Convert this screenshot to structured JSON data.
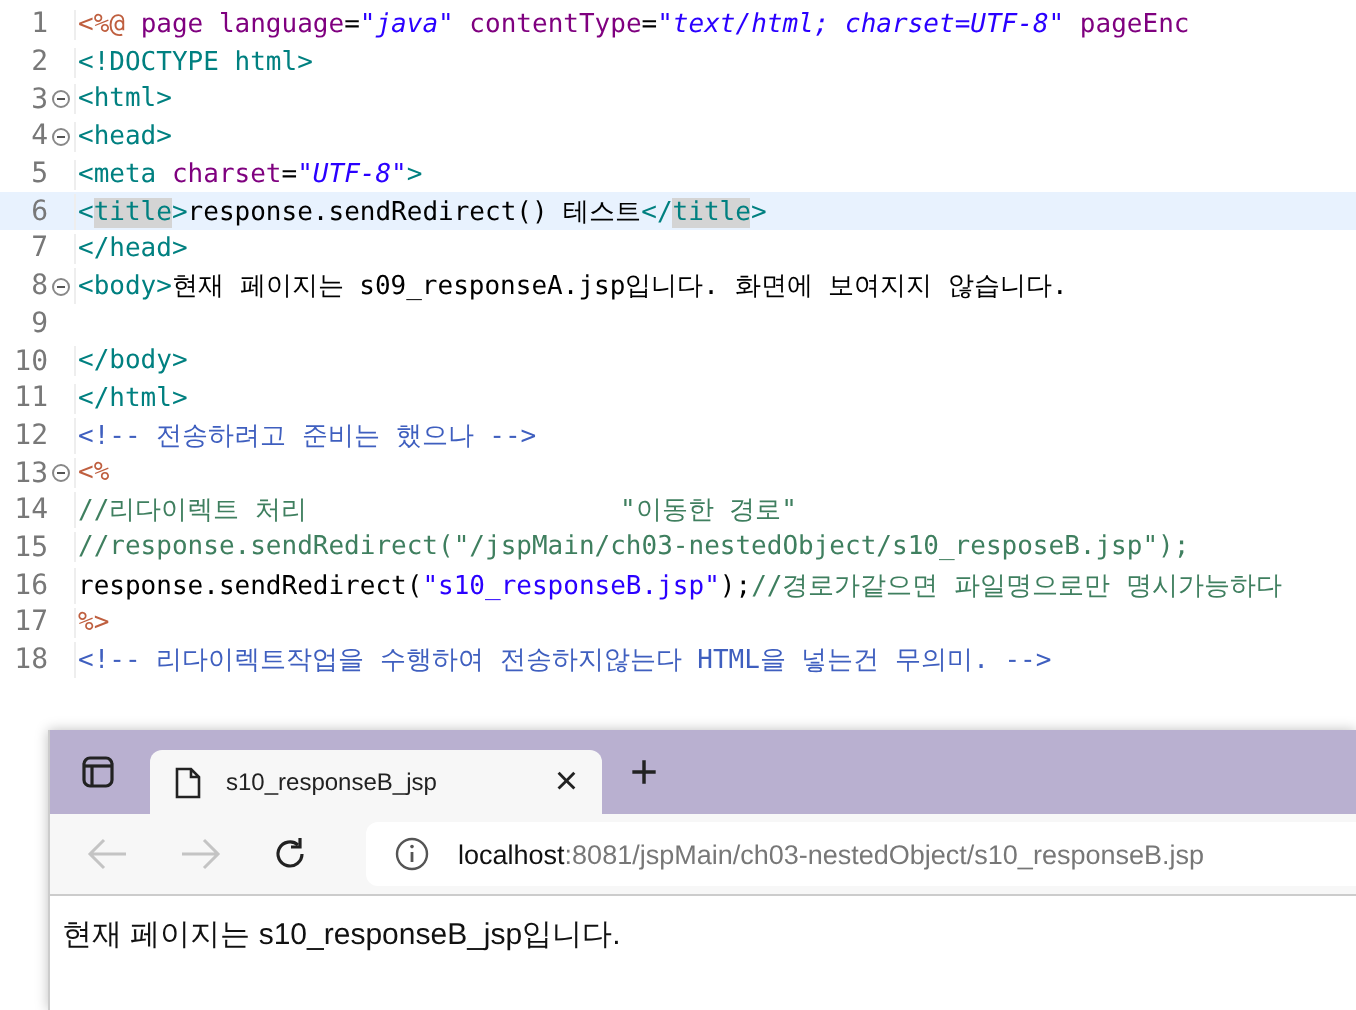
{
  "editor": {
    "lines": [
      {
        "number": "1",
        "foldable": false,
        "current": false,
        "tokens": [
          {
            "kind": "directive",
            "text": "<%@ "
          },
          {
            "kind": "attr",
            "text": "page language"
          },
          {
            "kind": "text",
            "text": "="
          },
          {
            "kind": "string",
            "text": "\"java\""
          },
          {
            "kind": "attr",
            "text": " contentType"
          },
          {
            "kind": "text",
            "text": "="
          },
          {
            "kind": "string",
            "text": "\"text/html; charset=UTF-8\""
          },
          {
            "kind": "attr",
            "text": " pageEnc"
          }
        ]
      },
      {
        "number": "2",
        "foldable": false,
        "current": false,
        "tokens": [
          {
            "kind": "tag",
            "text": "<!DOCTYPE html>"
          }
        ]
      },
      {
        "number": "3",
        "foldable": true,
        "current": false,
        "tokens": [
          {
            "kind": "tag",
            "text": "<html>"
          }
        ]
      },
      {
        "number": "4",
        "foldable": true,
        "current": false,
        "tokens": [
          {
            "kind": "tag",
            "text": "<head>"
          }
        ]
      },
      {
        "number": "5",
        "foldable": false,
        "current": false,
        "tokens": [
          {
            "kind": "tag",
            "text": "<meta "
          },
          {
            "kind": "attr",
            "text": "charset"
          },
          {
            "kind": "text",
            "text": "="
          },
          {
            "kind": "string",
            "text": "\"UTF-8\""
          },
          {
            "kind": "tag",
            "text": ">"
          }
        ]
      },
      {
        "number": "6",
        "foldable": false,
        "current": true,
        "tokens": [
          {
            "kind": "tag",
            "text": "<"
          },
          {
            "kind": "tag-match",
            "text": "title"
          },
          {
            "kind": "tag",
            "text": ">"
          },
          {
            "kind": "text",
            "text": "response.sendRedirect() 테스트"
          },
          {
            "kind": "tag",
            "text": "</"
          },
          {
            "kind": "tag-match",
            "text": "title"
          },
          {
            "kind": "tag",
            "text": ">"
          }
        ]
      },
      {
        "number": "7",
        "foldable": false,
        "current": false,
        "tokens": [
          {
            "kind": "tag",
            "text": "</head>"
          }
        ]
      },
      {
        "number": "8",
        "foldable": true,
        "current": false,
        "tokens": [
          {
            "kind": "tag",
            "text": "<body>"
          },
          {
            "kind": "text",
            "text": "현재 페이지는 s09_responseA.jsp입니다. 화면에 보여지지 않습니다."
          }
        ]
      },
      {
        "number": "9",
        "foldable": false,
        "current": false
      },
      {
        "number": "10",
        "foldable": false,
        "current": false,
        "tokens": [
          {
            "kind": "tag",
            "text": "</body>"
          }
        ]
      },
      {
        "number": "11",
        "foldable": false,
        "current": false,
        "tokens": [
          {
            "kind": "tag",
            "text": "</html>"
          }
        ]
      },
      {
        "number": "12",
        "foldable": false,
        "current": false,
        "tokens": [
          {
            "kind": "comment",
            "text": "<!-- 전송하려고 준비는 했으나 -->"
          }
        ]
      },
      {
        "number": "13",
        "foldable": true,
        "current": false,
        "tokens": [
          {
            "kind": "directive",
            "text": "<%"
          }
        ]
      },
      {
        "number": "14",
        "foldable": false,
        "current": false,
        "tokens": [
          {
            "kind": "jcomment",
            "text": "//리다이렉트 처리                    \"이동한 경로\""
          }
        ]
      },
      {
        "number": "15",
        "foldable": false,
        "current": false,
        "tokens": [
          {
            "kind": "jcomment",
            "text": "//response.sendRedirect(\"/jspMain/ch03-nestedObject/s10_resposeB.jsp\");"
          }
        ]
      },
      {
        "number": "16",
        "foldable": false,
        "current": false,
        "tokens": [
          {
            "kind": "text",
            "text": "response.sendRedirect("
          },
          {
            "kind": "jstring",
            "text": "\"s10_responseB.jsp\""
          },
          {
            "kind": "text",
            "text": ");"
          },
          {
            "kind": "jcomment",
            "text": "//경로가같으면 파일명으로만 명시가능하다"
          }
        ]
      },
      {
        "number": "17",
        "foldable": false,
        "current": false,
        "tokens": [
          {
            "kind": "directive",
            "text": "%>"
          }
        ]
      },
      {
        "number": "18",
        "foldable": false,
        "current": false,
        "tokens": [
          {
            "kind": "comment",
            "text": "<!-- 리다이렉트작업을 수행하여 전송하지않는다 HTML을 넣는건 무의미. -->"
          }
        ]
      }
    ]
  },
  "browser": {
    "tabs": [
      {
        "title": "s10_responseB_jsp",
        "selected": true,
        "close": "×"
      }
    ],
    "new_tab": "+",
    "back_disabled": true,
    "forward_disabled": true,
    "address": {
      "host": "localhost",
      "path": ":8081/jspMain/ch03-nestedObject/s10_responseB.jsp"
    },
    "content": "현재 페이지는 s10_responseB_jsp입니다."
  }
}
